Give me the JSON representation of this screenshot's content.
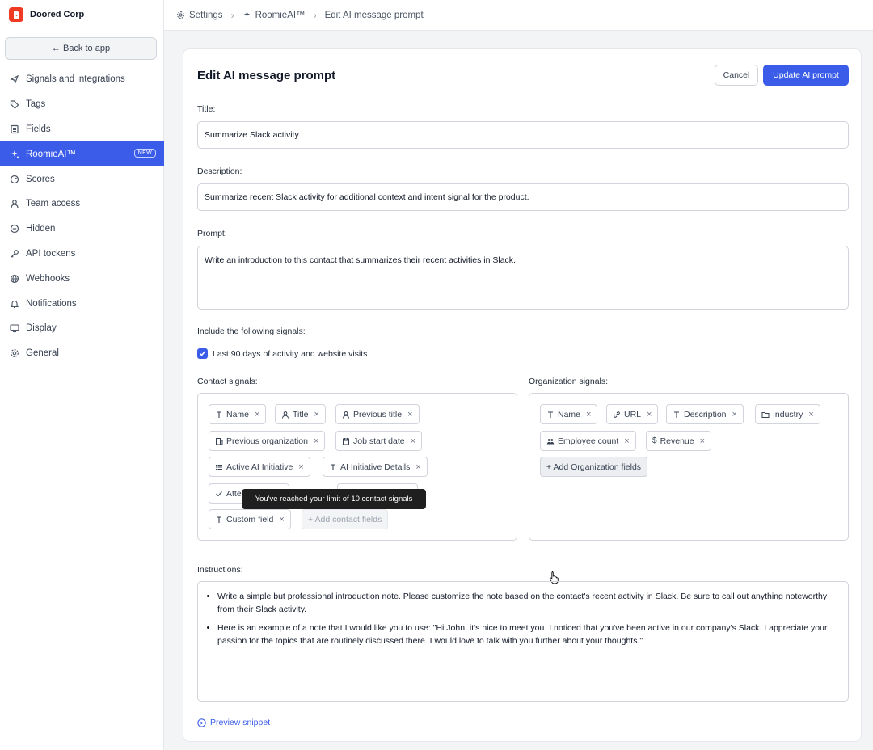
{
  "brand": {
    "name": "Doored Corp"
  },
  "sidebar": {
    "back_label": "← Back to app",
    "items": [
      {
        "label": "Signals and integrations",
        "icon": "signal-icon"
      },
      {
        "label": "Tags",
        "icon": "tag-icon"
      },
      {
        "label": "Fields",
        "icon": "fields-icon"
      },
      {
        "label": "RoomieAI™",
        "icon": "sparkle-icon",
        "active": true,
        "badge": "NEW"
      },
      {
        "label": "Scores",
        "icon": "score-icon"
      },
      {
        "label": "Team access",
        "icon": "user-icon"
      },
      {
        "label": "Hidden",
        "icon": "hidden-icon"
      },
      {
        "label": "API tockens",
        "icon": "key-icon"
      },
      {
        "label": "Webhooks",
        "icon": "globe-icon"
      },
      {
        "label": "Notifications",
        "icon": "bell-icon"
      },
      {
        "label": "Display",
        "icon": "monitor-icon"
      },
      {
        "label": "General",
        "icon": "gear-icon"
      }
    ]
  },
  "breadcrumb": {
    "settings": "Settings",
    "roomie": "RoomieAI™",
    "current": "Edit AI message prompt"
  },
  "page": {
    "title": "Edit AI message prompt",
    "cancel_label": "Cancel",
    "update_label": "Update AI prompt"
  },
  "form": {
    "title_label": "Title:",
    "title_value": "Summarize Slack activity",
    "description_label": "Description:",
    "description_value": "Summarize recent Slack activity for additional context and intent signal for the product.",
    "prompt_label": "Prompt:",
    "prompt_value": "Write an introduction to this contact that summarizes their recent activities in Slack.",
    "signals_label": "Include the following signals:",
    "checkbox_label": "Last 90 days of activity and website visits",
    "contact_label": "Contact signals:",
    "org_label": "Organization signals:",
    "contact_chips": [
      "Name",
      "Title",
      "Previous title",
      "Previous organization",
      "Job start date",
      "Active AI Initiative",
      "AI Initiative Details",
      "Atte",
      "Custom field"
    ],
    "add_contact": "+ Add contact fields",
    "org_chips": [
      "Name",
      "URL",
      "Description",
      "Industry",
      "Employee count",
      "Revenue"
    ],
    "add_org": "+ Add Organization fields",
    "tooltip": "You've reached your limit of 10 contact signals",
    "instructions_label": "Instructions:",
    "instructions": [
      "Write a simple but professional introduction note. Please customize the note based on the contact's recent activity in Slack. Be sure to call out anything noteworthy from their Slack activity.",
      "Here is an example of a note that I would like you to use: \"Hi John, it's nice to meet you. I noticed that you've been active in our company's Slack. I appreciate your passion for the topics that are routinely discussed there. I would love to talk with you further about your thoughts.\""
    ],
    "preview_label": "Preview snippet"
  },
  "colors": {
    "accent": "#3b5ce8",
    "brand": "#ef3b24"
  }
}
